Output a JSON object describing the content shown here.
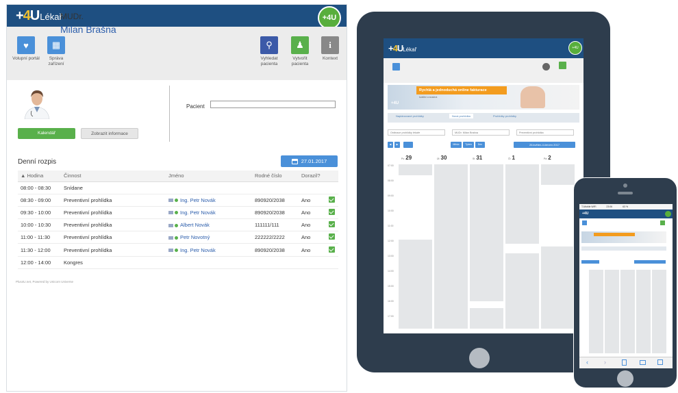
{
  "app": {
    "logo_prefix": "+",
    "logo_four": "4",
    "logo_u": "U",
    "logo_suffix": "Lékař",
    "badge": "+4U"
  },
  "toolbar_left": [
    {
      "label": "Volupní portál",
      "icon": "heart-icon"
    },
    {
      "label": "Správa zařízení",
      "icon": "building-icon"
    }
  ],
  "toolbar_right": [
    {
      "label": "Vyhledat pacienta",
      "icon": "search-icon"
    },
    {
      "label": "Vytvořit pacienta",
      "icon": "person-icon"
    },
    {
      "label": "Kontext",
      "icon": "info-icon"
    }
  ],
  "doctor": {
    "title": "MUDr.",
    "name": "Milan Brašna"
  },
  "patient_label": "Pacient",
  "buttons": {
    "calendar": "Kalendář",
    "info": "Zobrazit informace"
  },
  "schedule": {
    "title": "Denní rozpis",
    "date": "27.01.2017",
    "columns": [
      "▲ Hodina",
      "Činnost",
      "Jméno",
      "Rodné číslo",
      "Dorazil?"
    ],
    "rows": [
      {
        "time": "08:00 - 08:30",
        "activity": "Snídane",
        "name": "",
        "rc": "",
        "arrived": "",
        "check": false
      },
      {
        "time": "08:30 - 09:00",
        "activity": "Preventivní prohlídka",
        "name": "Ing. Petr Novák",
        "rc": "890920/2038",
        "arrived": "Ano",
        "check": true
      },
      {
        "time": "09:30 - 10:00",
        "activity": "Preventivní prohlídka",
        "name": "Ing. Petr Novák",
        "rc": "890920/2038",
        "arrived": "Ano",
        "check": true
      },
      {
        "time": "10:00 - 10:30",
        "activity": "Preventivní prohlídka",
        "name": "Albert Novák",
        "rc": "111111/111",
        "arrived": "Ano",
        "check": true
      },
      {
        "time": "11:00 - 11:30",
        "activity": "Preventivní prohlídka",
        "name": "Petr Novotný",
        "rc": "222222/2222",
        "arrived": "Ano",
        "check": true
      },
      {
        "time": "11:30 - 12:00",
        "activity": "Preventivní prohlídka",
        "name": "Ing. Petr Novák",
        "rc": "890920/2038",
        "arrived": "Ano",
        "check": true
      },
      {
        "time": "12:00 - 14:00",
        "activity": "Kongres",
        "name": "",
        "rc": "",
        "arrived": "",
        "check": false
      }
    ]
  },
  "footer": "Plus4U.net, Powered by Unicorn Universe",
  "tablet": {
    "banner_headline": "Rychlá a jednoduchá online fakturace",
    "banner_sub": "kvalitní a snadná",
    "tabs": [
      "Naplánované prohlídky",
      "Nová prohlídka",
      "Prohlídky prohlídky"
    ],
    "filters": [
      "Ordinace prohlídky lékaře",
      "MUDr. Milan Brašna",
      "Preventivní prohlídka"
    ],
    "nav_buttons": [
      "Měsíc",
      "Týden",
      "Den"
    ],
    "range_button": "26.květen-4.červen 2017",
    "days": [
      {
        "label": "Po",
        "num": "29"
      },
      {
        "label": "Út",
        "num": "30"
      },
      {
        "label": "St",
        "num": "31"
      },
      {
        "label": "Čt",
        "num": "1"
      },
      {
        "label": "Pá",
        "num": "2"
      }
    ],
    "times": [
      "07:00",
      "08:00",
      "09:00",
      "10:00",
      "11:00",
      "12:00",
      "13:00",
      "14:00",
      "15:00",
      "16:00",
      "17:00"
    ]
  },
  "phone": {
    "status_left": "T-Mobile WiFi",
    "status_time": "23:06",
    "status_right": "63 %"
  },
  "colors": {
    "header": "#1e4f81",
    "accent": "#4a90d9",
    "green": "#59b04b",
    "device": "#2e3d4d"
  }
}
